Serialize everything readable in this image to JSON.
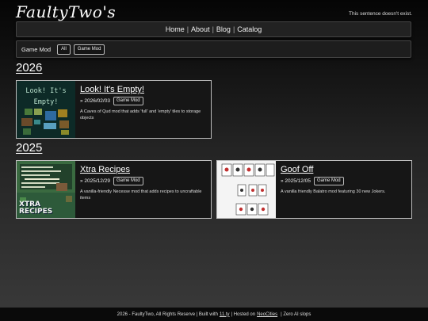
{
  "site": {
    "logo": "FaultyTwo's",
    "tagline": "This sentence doesn't exist."
  },
  "nav": {
    "items": [
      "Home",
      "About",
      "Blog",
      "Catalog"
    ],
    "separator": "|"
  },
  "filter": {
    "title": "Game Mod",
    "pills": [
      "All",
      "Game Mod"
    ]
  },
  "sections": [
    {
      "year": "2026",
      "posts": [
        {
          "title": "Look! It's Empty!",
          "date": "» 2026/02/03",
          "tag": "Game Mod",
          "desc": "A Caves of Qud mod that adds 'full' and 'empty' tiles to storage objects",
          "thumb_text": "Look! It's Empty!"
        }
      ]
    },
    {
      "year": "2025",
      "posts": [
        {
          "title": "Xtra Recipes",
          "date": "» 2025/12/29",
          "tag": "Game Mod",
          "desc": "A vanilla-friendly Necesse mod that adds recipes to uncraftable items",
          "thumb_text": "XTRA RECIPES"
        },
        {
          "title": "Goof Off",
          "date": "» 2025/12/05",
          "tag": "Game Mod",
          "desc": "A vanilla friendly Balatro mod featuring 30 new Jokers."
        }
      ]
    }
  ],
  "footer": {
    "prefix": "2026 - FaultyTwo, All Rights Reserve | Built with",
    "link1": "11.ty",
    "middle": "| Hosted on",
    "link2": "NeoCities",
    "suffix": "| Zero AI slops"
  },
  "colors": {
    "card_border": "#bcbcbc",
    "card_bg": "#161616",
    "qud_bg": "#0d2a27",
    "qud_text": "#b8e0cc",
    "necesse_bg": "#2d5a3a",
    "balatro_felt": "#f4f4f4"
  }
}
